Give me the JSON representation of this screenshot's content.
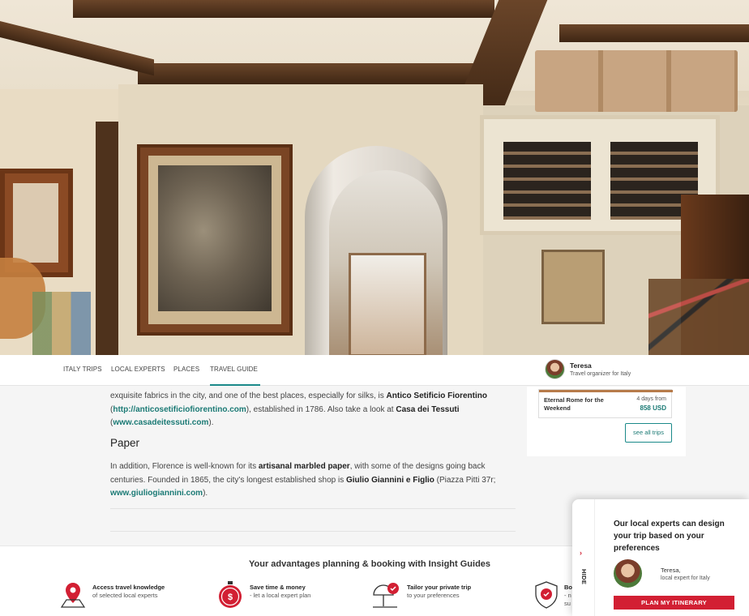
{
  "nav": {
    "tabs": [
      {
        "label": "ITALY TRIPS"
      },
      {
        "label": "LOCAL EXPERTS"
      },
      {
        "label": "PLACES"
      },
      {
        "label": "TRAVEL GUIDE"
      }
    ],
    "organizer": {
      "name": "Teresa",
      "role": "Travel organizer for Italy"
    }
  },
  "article": {
    "p1_pre": "exquisite fabrics in the city, and one of the best places, especially for silks, is ",
    "p1_b1": "Antico Setificio Fiorentino",
    "p1_open": " (",
    "p1_link1": "http://anticosetificiofiorentino.com",
    "p1_mid": "), established in 1786. Also take a look at ",
    "p1_b2": "Casa dei Tessuti",
    "p1_open2": " (",
    "p1_link2": "www.casadeitessuti.com",
    "p1_end": ").",
    "heading": "Paper",
    "p2_pre": "In addition, Florence is well-known for its ",
    "p2_b1": "artisanal marbled paper",
    "p2_mid": ", with some of the designs going back centuries. Founded in 1865, the city's longest established shop is ",
    "p2_b2": "Giulio Giannini e Figlio",
    "p2_mid2": " (Piazza Pitti 37r; ",
    "p2_link": "www.giuliogiannini.com",
    "p2_end": ")."
  },
  "sidebar": {
    "trip": {
      "name": "Eternal Rome for the Weekend",
      "days": "4 days from",
      "price": "858 USD"
    },
    "see_all": "see all trips"
  },
  "advantages": {
    "title": "Your advantages planning & booking with Insight Guides",
    "items": [
      {
        "icon": "map-pin-icon",
        "title": "Access travel knowledge",
        "sub": "of selected local experts"
      },
      {
        "icon": "stopwatch-icon",
        "title": "Save time & money",
        "sub": "- let a local expert plan"
      },
      {
        "icon": "umbrella-heart-icon",
        "title": "Tailor your private trip",
        "sub": "to your preferences"
      },
      {
        "icon": "shield-heart-icon",
        "title": "Bo",
        "sub": "- n"
      }
    ],
    "item4_sub2": "su"
  },
  "popup": {
    "hide_label": "HIDE",
    "message": "Our local experts can design your trip based on your preferences",
    "expert_name": "Teresa,",
    "expert_role": "local expert for Italy",
    "cta": "PLAN MY ITINERARY"
  },
  "colors": {
    "accent": "#1b8a8a",
    "cta": "#d21f33"
  }
}
